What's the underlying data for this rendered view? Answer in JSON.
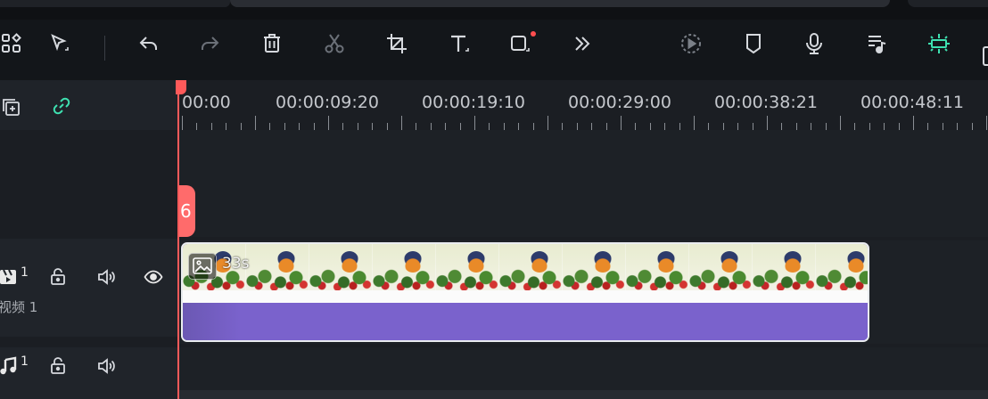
{
  "toolbar": {
    "tools": [
      {
        "name": "layout-grid-icon"
      },
      {
        "name": "select-cursor-icon"
      },
      {
        "name": "undo-icon"
      },
      {
        "name": "redo-icon"
      },
      {
        "name": "delete-icon"
      },
      {
        "name": "cut-icon"
      },
      {
        "name": "crop-icon"
      },
      {
        "name": "text-icon"
      },
      {
        "name": "shape-icon"
      },
      {
        "name": "more-icon"
      },
      {
        "name": "render-preview-icon"
      },
      {
        "name": "marker-icon"
      },
      {
        "name": "microphone-icon"
      },
      {
        "name": "audio-list-icon"
      },
      {
        "name": "snap-icon"
      }
    ],
    "accent_color": "#3ee0b0",
    "badge_color": "#ff4d4f"
  },
  "ruler": {
    "labels": [
      "00:00",
      "00:00:09:20",
      "00:00:19:10",
      "00:00:29:00",
      "00:00:38:21",
      "00:00:48:11"
    ]
  },
  "tracks": {
    "video": {
      "number": "1",
      "name": "视频 1"
    },
    "audio": {
      "number": "1"
    }
  },
  "marker": {
    "label": "6"
  },
  "clip": {
    "duration_label": "33s",
    "color": "#7a62cc"
  },
  "playhead": {
    "color": "#ff5a5a"
  }
}
